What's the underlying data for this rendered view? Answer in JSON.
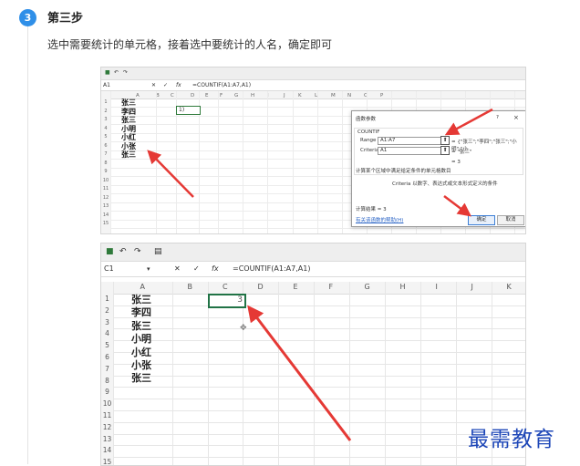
{
  "step": {
    "number": "3",
    "title": "第三步",
    "description": "选中需要统计的单元格，接着选中要统计的人名，确定即可"
  },
  "shot1": {
    "name_box": "A1",
    "formula": "=COUNTIF(A1:A7,A1)",
    "columns": [
      "A",
      "B",
      "C",
      "D",
      "E",
      "F",
      "G",
      "H",
      "I",
      "J",
      "K",
      "L",
      "M",
      "N",
      "O",
      "P"
    ],
    "rows": [
      "1",
      "2",
      "3",
      "4",
      "5",
      "6",
      "7",
      "8",
      "9",
      "10",
      "11",
      "12",
      "13",
      "14",
      "15"
    ],
    "names": [
      "张三",
      "李四",
      "张三",
      "小明",
      "小红",
      "小张",
      "张三"
    ],
    "active_cell_text": "1)",
    "dialog": {
      "title": "函数参数",
      "help": "?",
      "close": "×",
      "function_name": "COUNTIF",
      "range_label": "Range",
      "range_value": "A1:A7",
      "range_result": "= {\"张三\";\"李四\";\"张三\";\"小明\";\"小",
      "criteria_label": "Criteria",
      "criteria_value": "A1",
      "criteria_result": "= \"张三\"",
      "result_line": "= 3",
      "description": "计算某个区域中满足给定条件的单元格数目",
      "criteria_help": "Criteria  以数字、表达式或文本形式定义的条件",
      "calc_result": "计算结果 =  3",
      "help_link": "有关该函数的帮助(H)",
      "ok": "确定",
      "cancel": "取消"
    }
  },
  "shot2": {
    "name_box": "C1",
    "fx": "fx",
    "formula": "=COUNTIF(A1:A7,A1)",
    "columns": [
      "A",
      "B",
      "C",
      "D",
      "E",
      "F",
      "G",
      "H",
      "I",
      "J",
      "K"
    ],
    "rows": [
      "1",
      "2",
      "3",
      "4",
      "5",
      "6",
      "7",
      "8",
      "9",
      "10",
      "11",
      "12",
      "13",
      "14",
      "15"
    ],
    "names": [
      "张三",
      "李四",
      "张三",
      "小明",
      "小红",
      "小张",
      "张三"
    ],
    "result_value": "3"
  },
  "watermark": "最需教育",
  "colors": {
    "accent": "#2f8fe8",
    "excel_green": "#217346",
    "arrow": "#e53935",
    "watermark": "#1e47b8"
  }
}
